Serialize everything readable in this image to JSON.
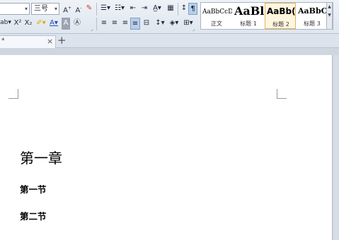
{
  "toolbar": {
    "font_size": "三号",
    "row1": [
      {
        "name": "grow-font-icon",
        "glyph": "A⁺"
      },
      {
        "name": "shrink-font-icon",
        "glyph": "A⁻"
      },
      {
        "name": "clear-format-icon",
        "glyph": "✎"
      },
      {
        "name": "bullets-icon",
        "glyph": "☰"
      },
      {
        "name": "numbering-icon",
        "glyph": "☷"
      },
      {
        "name": "decrease-indent-icon",
        "glyph": "⇤"
      },
      {
        "name": "increase-indent-icon",
        "glyph": "⇥"
      },
      {
        "name": "chinese-layout-icon",
        "glyph": "A"
      },
      {
        "name": "table-icon",
        "glyph": "▦"
      },
      {
        "name": "sort-icon",
        "glyph": "↕"
      },
      {
        "name": "show-marks-icon",
        "glyph": "¶"
      }
    ],
    "row2": [
      {
        "name": "char-case-icon",
        "glyph": "ab"
      },
      {
        "name": "superscript-icon",
        "glyph": "X²"
      },
      {
        "name": "subscript-icon",
        "glyph": "X₂"
      },
      {
        "name": "highlight-icon",
        "glyph": "✐"
      },
      {
        "name": "font-color-icon",
        "glyph": "A"
      },
      {
        "name": "char-shading-icon",
        "glyph": "A"
      },
      {
        "name": "char-border-icon",
        "glyph": "Ⓐ"
      },
      {
        "name": "align-left-icon",
        "glyph": "≡"
      },
      {
        "name": "align-center-icon",
        "glyph": "≡"
      },
      {
        "name": "align-right-icon",
        "glyph": "≡"
      },
      {
        "name": "justify-icon",
        "glyph": "≡"
      },
      {
        "name": "distributed-icon",
        "glyph": "⊟"
      },
      {
        "name": "line-spacing-icon",
        "glyph": "↕≡"
      },
      {
        "name": "shading-icon",
        "glyph": "◈"
      },
      {
        "name": "borders-icon",
        "glyph": "⊞"
      }
    ]
  },
  "styles": [
    {
      "preview": "AaBbCcDc",
      "name": "正文"
    },
    {
      "preview": "AaBl",
      "name": "标题 1"
    },
    {
      "preview": "AaBb(",
      "name": "标题 2"
    },
    {
      "preview": "AaBbC",
      "name": "标题 3"
    }
  ],
  "tab": {
    "title": "*",
    "close": "×",
    "new": "+"
  },
  "document": {
    "heading1": "第一章",
    "section1": "第一节",
    "section2": "第二节"
  }
}
